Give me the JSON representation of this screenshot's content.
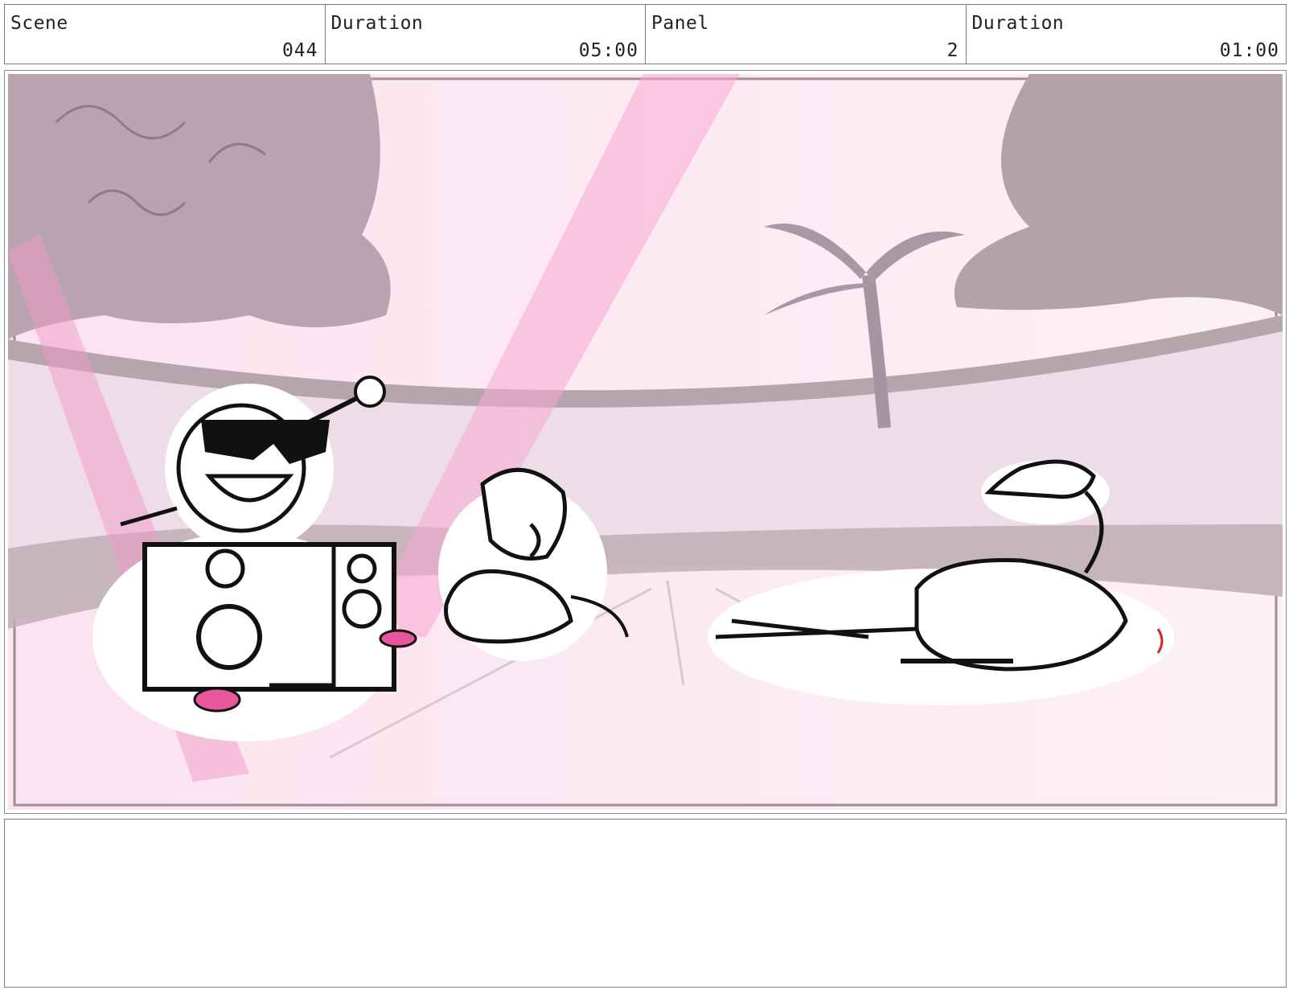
{
  "header": {
    "scene_label": "Scene",
    "scene_value": "044",
    "scene_duration_label": "Duration",
    "scene_duration_value": "05:00",
    "panel_label": "Panel",
    "panel_value": "2",
    "panel_duration_label": "Duration",
    "panel_duration_value": "01:00"
  },
  "colors": {
    "sky": "#fbe6f1",
    "foliage": "#b9a7b0",
    "light_beam": "#f7a8d2",
    "accent_pink": "#e8579d",
    "line": "#111111"
  },
  "notes": {
    "text": ""
  }
}
